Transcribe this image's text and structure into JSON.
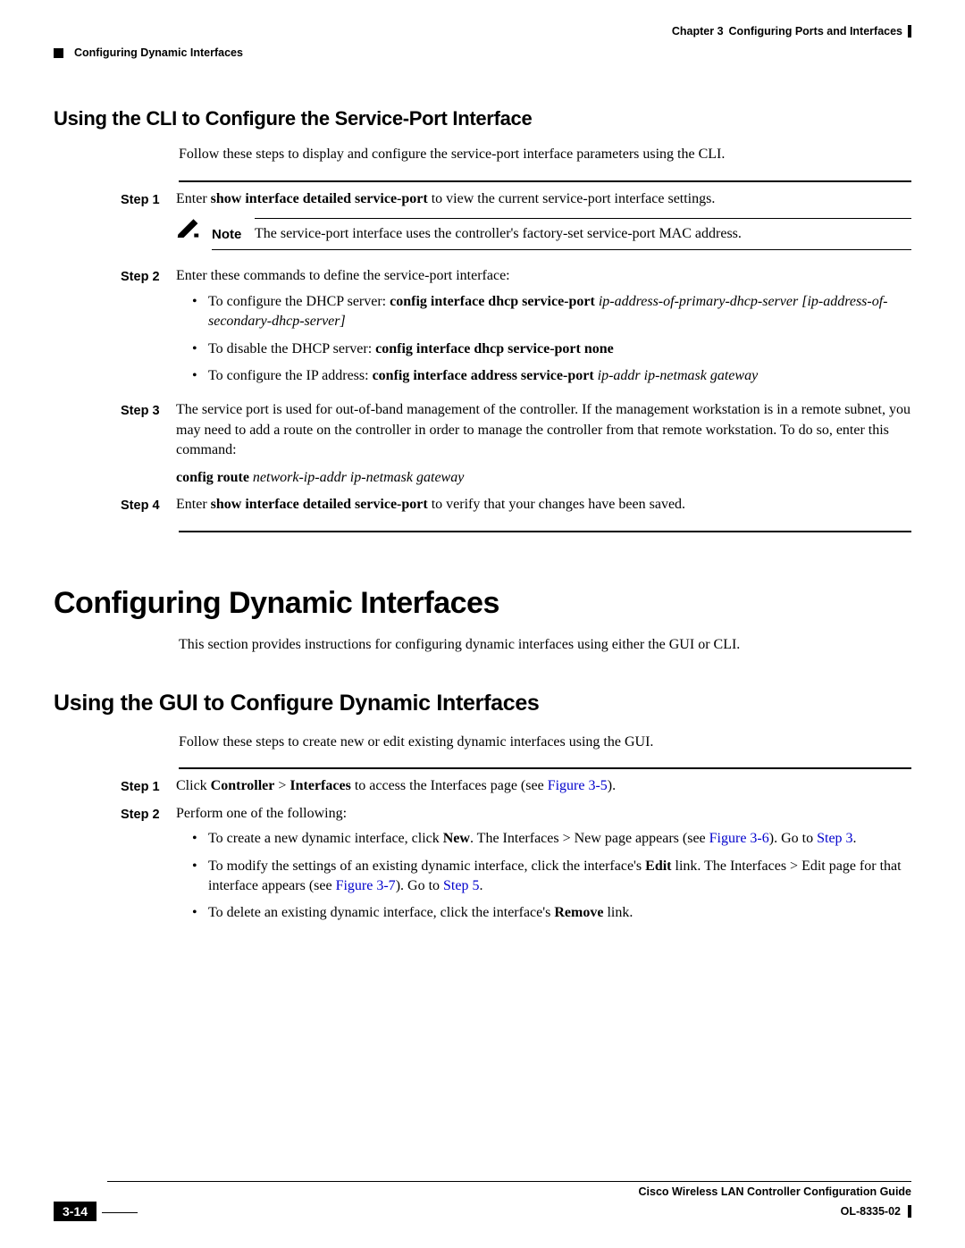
{
  "header": {
    "chapter": "Chapter 3",
    "title": "Configuring Ports and Interfaces",
    "section_top": "Configuring Dynamic Interfaces"
  },
  "section1": {
    "heading": "Using the CLI to Configure the Service-Port Interface",
    "intro": "Follow these steps to display and configure the service-port interface parameters using the CLI."
  },
  "steps1": {
    "s1_label": "Step 1",
    "s1_a": "Enter ",
    "s1_b": "show interface detailed service-port",
    "s1_c": " to view the current service-port interface settings.",
    "note_label": "Note",
    "note_text": "The service-port interface uses the controller's factory-set service-port MAC address.",
    "s2_label": "Step 2",
    "s2_intro": "Enter these commands to define the service-port interface:",
    "s2_b1_a": "To configure the DHCP server: ",
    "s2_b1_b": "config interface dhcp service-port",
    "s2_b1_c": " ip-address-of-primary-dhcp-server",
    "s2_b1_d": " [",
    "s2_b1_e": "ip-address-of-secondary-dhcp-server",
    "s2_b1_f": "]",
    "s2_b2_a": "To disable the DHCP server: ",
    "s2_b2_b": "config interface dhcp service-port none",
    "s2_b3_a": "To configure the IP address: ",
    "s2_b3_b": "config interface address service-port",
    "s2_b3_c": " ip-addr ip-netmask gateway",
    "s3_label": "Step 3",
    "s3_text": "The service port is used for out-of-band management of the controller. If the management workstation is in a remote subnet, you may need to add a route on the controller in order to manage the controller from that remote workstation. To do so, enter this command:",
    "s3_cmd_a": "config route",
    "s3_cmd_b": " network-ip-addr ip-netmask gateway",
    "s4_label": "Step 4",
    "s4_a": "Enter ",
    "s4_b": "show interface detailed service-port",
    "s4_c": " to verify that your changes have been saved."
  },
  "section2": {
    "heading": "Configuring Dynamic Interfaces",
    "intro": "This section provides instructions for configuring dynamic interfaces using either the GUI or CLI."
  },
  "section3": {
    "heading": "Using the GUI to Configure Dynamic Interfaces",
    "intro": "Follow these steps to create new or edit existing dynamic interfaces using the GUI."
  },
  "steps2": {
    "s1_label": "Step 1",
    "s1_a": "Click ",
    "s1_b": "Controller",
    "s1_c": " > ",
    "s1_d": "Interfaces",
    "s1_e": " to access the Interfaces page (see ",
    "s1_f": "Figure 3-5",
    "s1_g": ").",
    "s2_label": "Step 2",
    "s2_intro": "Perform one of the following:",
    "s2_b1_a": "To create a new dynamic interface, click ",
    "s2_b1_b": "New",
    "s2_b1_c": ". The Interfaces > New page appears (see ",
    "s2_b1_d": "Figure 3-6",
    "s2_b1_e": "). Go to ",
    "s2_b1_f": "Step 3",
    "s2_b1_g": ".",
    "s2_b2_a": "To modify the settings of an existing dynamic interface, click the interface's ",
    "s2_b2_b": "Edit",
    "s2_b2_c": " link. The Interfaces > Edit page for that interface appears (see ",
    "s2_b2_d": "Figure 3-7",
    "s2_b2_e": "). Go to ",
    "s2_b2_f": "Step 5",
    "s2_b2_g": ".",
    "s2_b3_a": "To delete an existing dynamic interface, click the interface's ",
    "s2_b3_b": "Remove",
    "s2_b3_c": " link."
  },
  "footer": {
    "guide": "Cisco Wireless LAN Controller Configuration Guide",
    "page": "3-14",
    "docid": "OL-8335-02"
  }
}
